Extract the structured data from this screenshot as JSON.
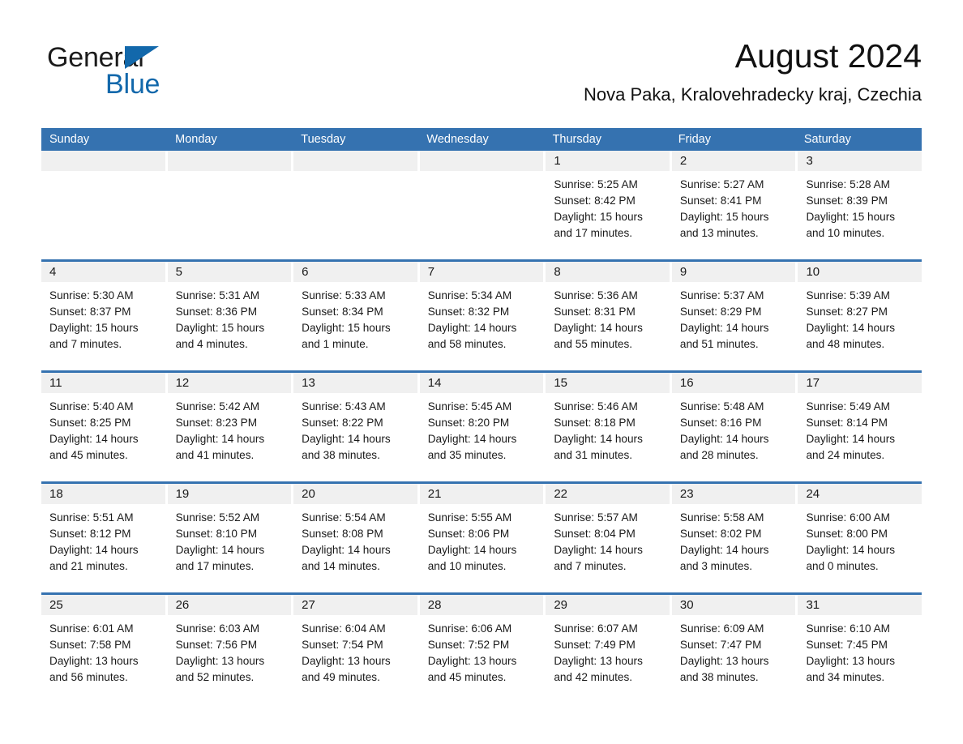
{
  "brand": {
    "name_part1": "General",
    "name_part2": "Blue",
    "accent_color": "#1268ab",
    "triangle_icon": "triangle-icon"
  },
  "header": {
    "month_title": "August 2024",
    "location": "Nova Paka, Kralovehradecky kraj, Czechia"
  },
  "calendar": {
    "header_bg": "#3572b0",
    "daynum_bg": "#f0f0f0",
    "weekday_headers": [
      "Sunday",
      "Monday",
      "Tuesday",
      "Wednesday",
      "Thursday",
      "Friday",
      "Saturday"
    ],
    "weeks": [
      [
        {
          "day": "",
          "empty": true
        },
        {
          "day": "",
          "empty": true
        },
        {
          "day": "",
          "empty": true
        },
        {
          "day": "",
          "empty": true
        },
        {
          "day": "1",
          "sunrise": "Sunrise: 5:25 AM",
          "sunset": "Sunset: 8:42 PM",
          "daylight_1": "Daylight: 15 hours",
          "daylight_2": "and 17 minutes."
        },
        {
          "day": "2",
          "sunrise": "Sunrise: 5:27 AM",
          "sunset": "Sunset: 8:41 PM",
          "daylight_1": "Daylight: 15 hours",
          "daylight_2": "and 13 minutes."
        },
        {
          "day": "3",
          "sunrise": "Sunrise: 5:28 AM",
          "sunset": "Sunset: 8:39 PM",
          "daylight_1": "Daylight: 15 hours",
          "daylight_2": "and 10 minutes."
        }
      ],
      [
        {
          "day": "4",
          "sunrise": "Sunrise: 5:30 AM",
          "sunset": "Sunset: 8:37 PM",
          "daylight_1": "Daylight: 15 hours",
          "daylight_2": "and 7 minutes."
        },
        {
          "day": "5",
          "sunrise": "Sunrise: 5:31 AM",
          "sunset": "Sunset: 8:36 PM",
          "daylight_1": "Daylight: 15 hours",
          "daylight_2": "and 4 minutes."
        },
        {
          "day": "6",
          "sunrise": "Sunrise: 5:33 AM",
          "sunset": "Sunset: 8:34 PM",
          "daylight_1": "Daylight: 15 hours",
          "daylight_2": "and 1 minute."
        },
        {
          "day": "7",
          "sunrise": "Sunrise: 5:34 AM",
          "sunset": "Sunset: 8:32 PM",
          "daylight_1": "Daylight: 14 hours",
          "daylight_2": "and 58 minutes."
        },
        {
          "day": "8",
          "sunrise": "Sunrise: 5:36 AM",
          "sunset": "Sunset: 8:31 PM",
          "daylight_1": "Daylight: 14 hours",
          "daylight_2": "and 55 minutes."
        },
        {
          "day": "9",
          "sunrise": "Sunrise: 5:37 AM",
          "sunset": "Sunset: 8:29 PM",
          "daylight_1": "Daylight: 14 hours",
          "daylight_2": "and 51 minutes."
        },
        {
          "day": "10",
          "sunrise": "Sunrise: 5:39 AM",
          "sunset": "Sunset: 8:27 PM",
          "daylight_1": "Daylight: 14 hours",
          "daylight_2": "and 48 minutes."
        }
      ],
      [
        {
          "day": "11",
          "sunrise": "Sunrise: 5:40 AM",
          "sunset": "Sunset: 8:25 PM",
          "daylight_1": "Daylight: 14 hours",
          "daylight_2": "and 45 minutes."
        },
        {
          "day": "12",
          "sunrise": "Sunrise: 5:42 AM",
          "sunset": "Sunset: 8:23 PM",
          "daylight_1": "Daylight: 14 hours",
          "daylight_2": "and 41 minutes."
        },
        {
          "day": "13",
          "sunrise": "Sunrise: 5:43 AM",
          "sunset": "Sunset: 8:22 PM",
          "daylight_1": "Daylight: 14 hours",
          "daylight_2": "and 38 minutes."
        },
        {
          "day": "14",
          "sunrise": "Sunrise: 5:45 AM",
          "sunset": "Sunset: 8:20 PM",
          "daylight_1": "Daylight: 14 hours",
          "daylight_2": "and 35 minutes."
        },
        {
          "day": "15",
          "sunrise": "Sunrise: 5:46 AM",
          "sunset": "Sunset: 8:18 PM",
          "daylight_1": "Daylight: 14 hours",
          "daylight_2": "and 31 minutes."
        },
        {
          "day": "16",
          "sunrise": "Sunrise: 5:48 AM",
          "sunset": "Sunset: 8:16 PM",
          "daylight_1": "Daylight: 14 hours",
          "daylight_2": "and 28 minutes."
        },
        {
          "day": "17",
          "sunrise": "Sunrise: 5:49 AM",
          "sunset": "Sunset: 8:14 PM",
          "daylight_1": "Daylight: 14 hours",
          "daylight_2": "and 24 minutes."
        }
      ],
      [
        {
          "day": "18",
          "sunrise": "Sunrise: 5:51 AM",
          "sunset": "Sunset: 8:12 PM",
          "daylight_1": "Daylight: 14 hours",
          "daylight_2": "and 21 minutes."
        },
        {
          "day": "19",
          "sunrise": "Sunrise: 5:52 AM",
          "sunset": "Sunset: 8:10 PM",
          "daylight_1": "Daylight: 14 hours",
          "daylight_2": "and 17 minutes."
        },
        {
          "day": "20",
          "sunrise": "Sunrise: 5:54 AM",
          "sunset": "Sunset: 8:08 PM",
          "daylight_1": "Daylight: 14 hours",
          "daylight_2": "and 14 minutes."
        },
        {
          "day": "21",
          "sunrise": "Sunrise: 5:55 AM",
          "sunset": "Sunset: 8:06 PM",
          "daylight_1": "Daylight: 14 hours",
          "daylight_2": "and 10 minutes."
        },
        {
          "day": "22",
          "sunrise": "Sunrise: 5:57 AM",
          "sunset": "Sunset: 8:04 PM",
          "daylight_1": "Daylight: 14 hours",
          "daylight_2": "and 7 minutes."
        },
        {
          "day": "23",
          "sunrise": "Sunrise: 5:58 AM",
          "sunset": "Sunset: 8:02 PM",
          "daylight_1": "Daylight: 14 hours",
          "daylight_2": "and 3 minutes."
        },
        {
          "day": "24",
          "sunrise": "Sunrise: 6:00 AM",
          "sunset": "Sunset: 8:00 PM",
          "daylight_1": "Daylight: 14 hours",
          "daylight_2": "and 0 minutes."
        }
      ],
      [
        {
          "day": "25",
          "sunrise": "Sunrise: 6:01 AM",
          "sunset": "Sunset: 7:58 PM",
          "daylight_1": "Daylight: 13 hours",
          "daylight_2": "and 56 minutes."
        },
        {
          "day": "26",
          "sunrise": "Sunrise: 6:03 AM",
          "sunset": "Sunset: 7:56 PM",
          "daylight_1": "Daylight: 13 hours",
          "daylight_2": "and 52 minutes."
        },
        {
          "day": "27",
          "sunrise": "Sunrise: 6:04 AM",
          "sunset": "Sunset: 7:54 PM",
          "daylight_1": "Daylight: 13 hours",
          "daylight_2": "and 49 minutes."
        },
        {
          "day": "28",
          "sunrise": "Sunrise: 6:06 AM",
          "sunset": "Sunset: 7:52 PM",
          "daylight_1": "Daylight: 13 hours",
          "daylight_2": "and 45 minutes."
        },
        {
          "day": "29",
          "sunrise": "Sunrise: 6:07 AM",
          "sunset": "Sunset: 7:49 PM",
          "daylight_1": "Daylight: 13 hours",
          "daylight_2": "and 42 minutes."
        },
        {
          "day": "30",
          "sunrise": "Sunrise: 6:09 AM",
          "sunset": "Sunset: 7:47 PM",
          "daylight_1": "Daylight: 13 hours",
          "daylight_2": "and 38 minutes."
        },
        {
          "day": "31",
          "sunrise": "Sunrise: 6:10 AM",
          "sunset": "Sunset: 7:45 PM",
          "daylight_1": "Daylight: 13 hours",
          "daylight_2": "and 34 minutes."
        }
      ]
    ]
  }
}
